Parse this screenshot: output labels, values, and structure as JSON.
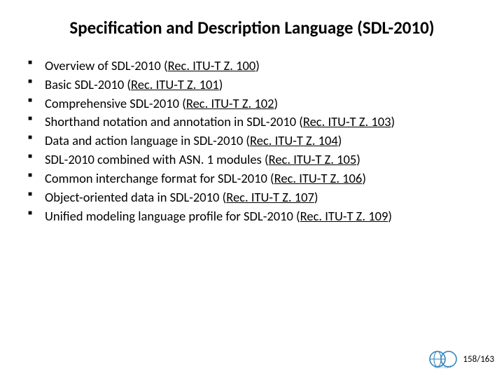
{
  "title": "Specification and Description Language (SDL-2010)",
  "items": [
    {
      "text": "Overview of SDL-2010 (",
      "ref": "Rec. ITU-T Z. 100",
      "tail": ")"
    },
    {
      "text": "Basic SDL-2010 (",
      "ref": "Rec. ITU-T Z. 101",
      "tail": ")"
    },
    {
      "text": "Comprehensive SDL-2010 (",
      "ref": "Rec. ITU-T Z. 102",
      "tail": ")"
    },
    {
      "text": "Shorthand notation and annotation in SDL-2010 (",
      "ref": "Rec. ITU-T Z. 103",
      "tail": ")"
    },
    {
      "text": "Data and action language in SDL-2010 (",
      "ref": "Rec. ITU-T Z. 104",
      "tail": ")"
    },
    {
      "text": "SDL-2010 combined with ASN. 1 modules (",
      "ref": "Rec. ITU-T Z. 105",
      "tail": ")"
    },
    {
      "text": "Common interchange format for SDL-2010 (",
      "ref": "Rec. ITU-T Z. 106",
      "tail": ")"
    },
    {
      "text": "Object-oriented data in SDL-2010 (",
      "ref": "Rec. ITU-T Z. 107",
      "tail": ")"
    },
    {
      "text": "Unified modeling language profile for SDL-2010 (",
      "ref": "Rec. ITU-T Z. 109",
      "tail": ")"
    }
  ],
  "page": {
    "current": "158",
    "total": "163",
    "sep": "/"
  },
  "logo_alt": "CCITT / ITU-T anniversary logo"
}
